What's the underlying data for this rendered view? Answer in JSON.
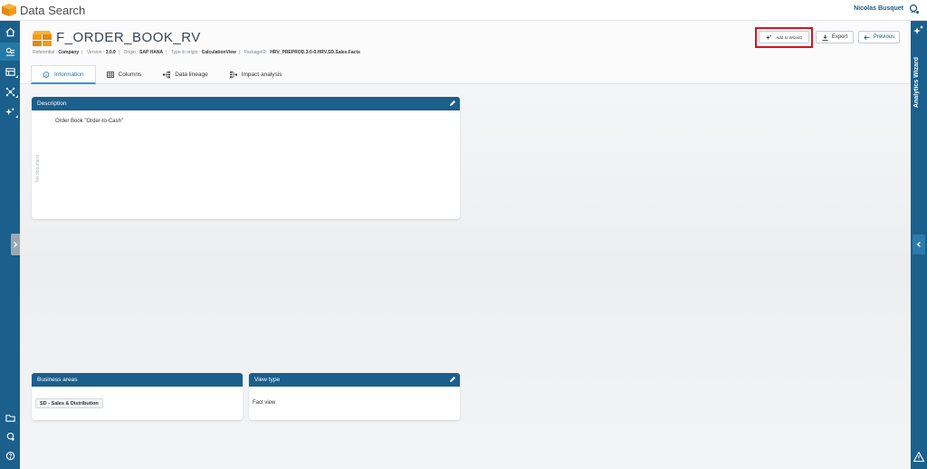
{
  "app": {
    "title": "Data Search",
    "user": "Nicolas Busquet"
  },
  "object": {
    "title": "F_ORDER_BOOK_RV",
    "meta": [
      {
        "label": "Referential :",
        "value": "Company"
      },
      {
        "label": "Version :",
        "value": "3.0.0"
      },
      {
        "label": "Origin :",
        "value": "SAP HANA"
      },
      {
        "label": "Type in origin :",
        "value": "CalculationView"
      },
      {
        "label": "PackageID :",
        "value": "HRV_PREPROD.3-0-0.HRV.SD.Sales.Facts"
      }
    ]
  },
  "actions": {
    "add_wizard": "Add to Wizard",
    "export": "Export",
    "previous": "Previous"
  },
  "tabs": [
    {
      "label": "Information",
      "icon": "info-icon"
    },
    {
      "label": "Columns",
      "icon": "grid-icon"
    },
    {
      "label": "Data lineage",
      "icon": "lineage-icon"
    },
    {
      "label": "Impact analysis",
      "icon": "impact-icon"
    }
  ],
  "description": {
    "header": "Description",
    "text": "Order Book \"Order-to-Cash\"",
    "side_label": "No document"
  },
  "business_areas": {
    "header": "Business areas",
    "chip": "SD - Sales & Distribution"
  },
  "view_type": {
    "header": "View type",
    "value": "Fact view"
  },
  "right_panel": {
    "title": "Analytics Wizard"
  },
  "colors": {
    "primary": "#1b5f8c",
    "accent": "#3b93c9",
    "highlight": "#e0101f",
    "logo": "#f39c12"
  }
}
